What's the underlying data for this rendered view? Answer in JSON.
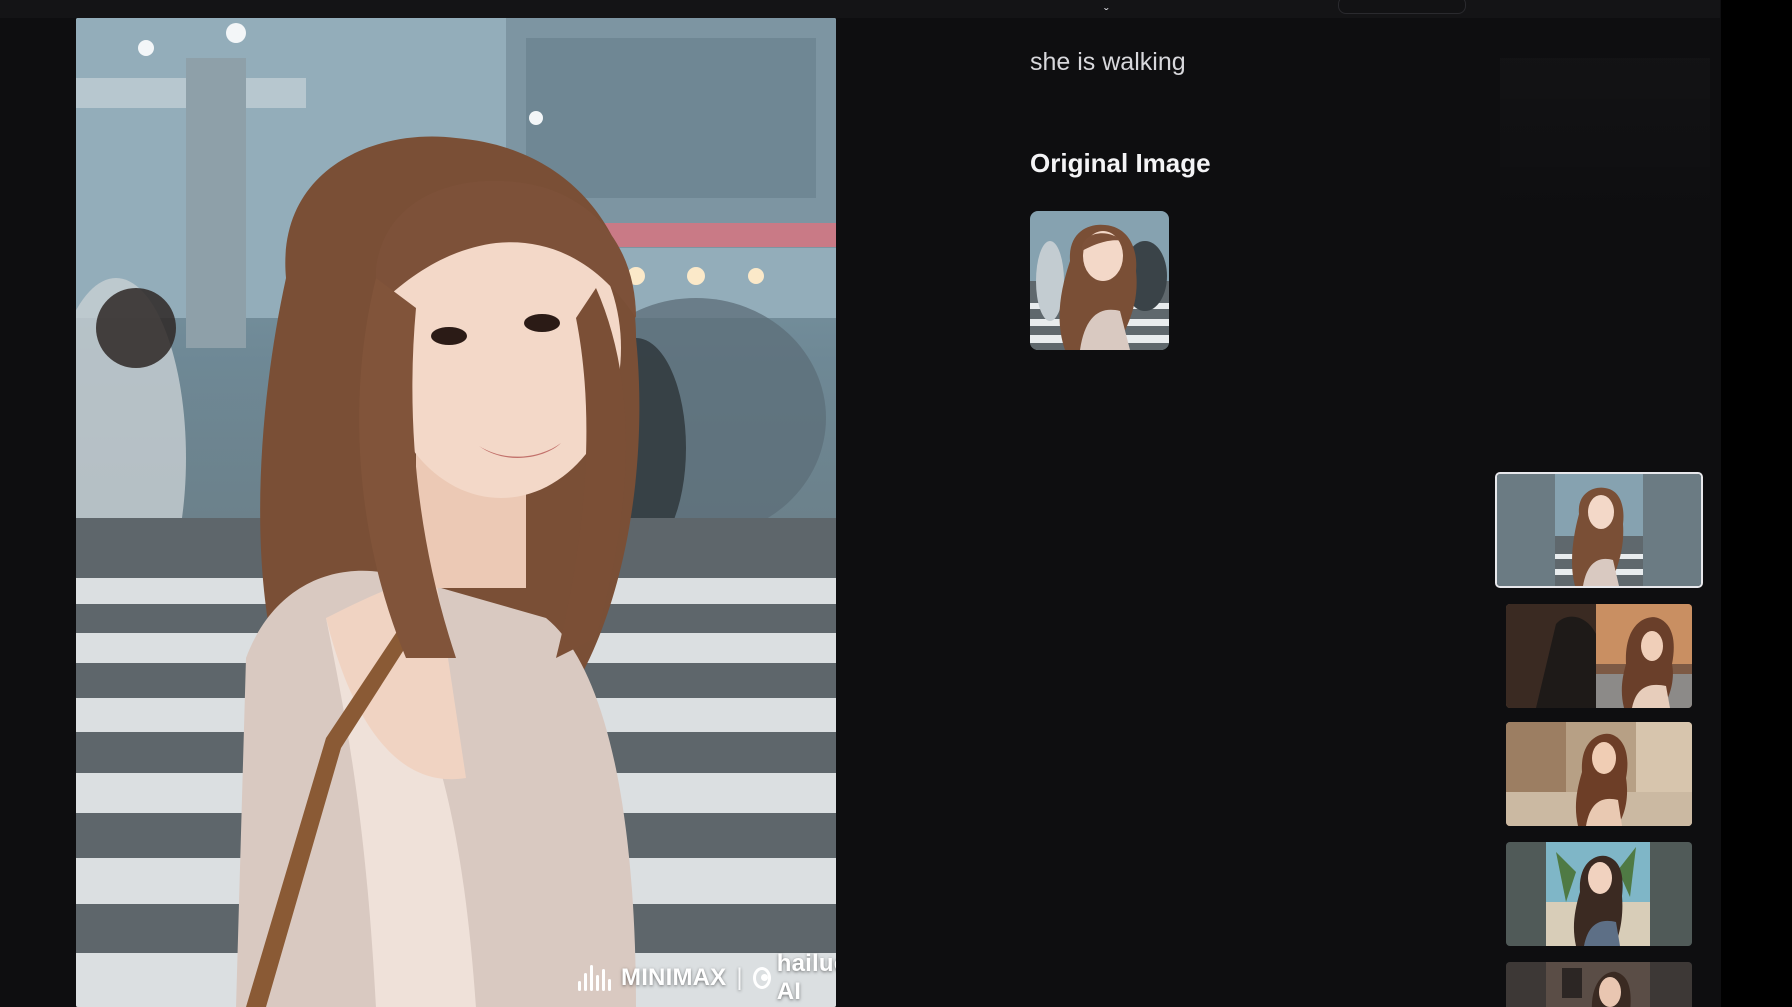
{
  "preview": {
    "watermark_brand": "MINIMAX",
    "watermark_separator": "|",
    "watermark_product": "hailuo AI",
    "colors": {
      "sky": "#8aa7b5",
      "crosswalk": "#e9ecee",
      "hair": "#7a4f36",
      "skin": "#f0d3c2"
    }
  },
  "info": {
    "prompt": "she is walking",
    "original_image_title": "Original Image"
  },
  "thumbnails": [
    {
      "name": "thumb-crosswalk-girl",
      "selected": true
    },
    {
      "name": "thumb-street-sunset",
      "selected": false
    },
    {
      "name": "thumb-alley-sunlight",
      "selected": false
    },
    {
      "name": "thumb-beach-palms",
      "selected": false
    },
    {
      "name": "thumb-indoor-portrait",
      "selected": false
    }
  ]
}
